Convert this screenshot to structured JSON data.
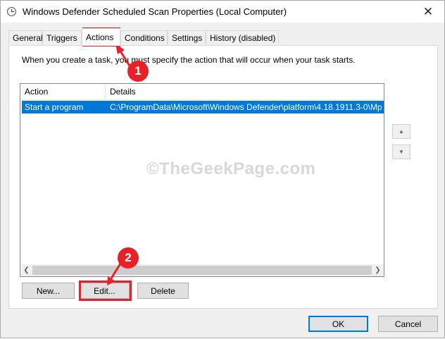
{
  "window": {
    "title": "Windows Defender Scheduled Scan Properties (Local Computer)",
    "close_glyph": "✕"
  },
  "tabs": [
    {
      "label": "General"
    },
    {
      "label": "Triggers"
    },
    {
      "label": "Actions"
    },
    {
      "label": "Conditions"
    },
    {
      "label": "Settings"
    },
    {
      "label": "History (disabled)"
    }
  ],
  "active_tab": "Actions",
  "actions_panel": {
    "description": "When you create a task, you must specify the action that will occur when your task starts.",
    "columns": [
      "Action",
      "Details"
    ],
    "rows": [
      {
        "action": "Start a program",
        "details": "C:\\ProgramData\\Microsoft\\Windows Defender\\platform\\4.18.1911.3-0\\Mp"
      }
    ],
    "move_up_glyph": "▲",
    "move_down_glyph": "▼",
    "scroll_left_glyph": "❮",
    "scroll_right_glyph": "❯"
  },
  "buttons": {
    "new": "New...",
    "edit": "Edit...",
    "delete": "Delete",
    "ok": "OK",
    "cancel": "Cancel"
  },
  "annotations": {
    "watermark": "©TheGeekPage.com",
    "step1": "1",
    "step2": "2",
    "highlight_color": "#e8202a"
  },
  "colors": {
    "selection": "#0078d7",
    "dialog_bg": "#f0f0f0"
  }
}
